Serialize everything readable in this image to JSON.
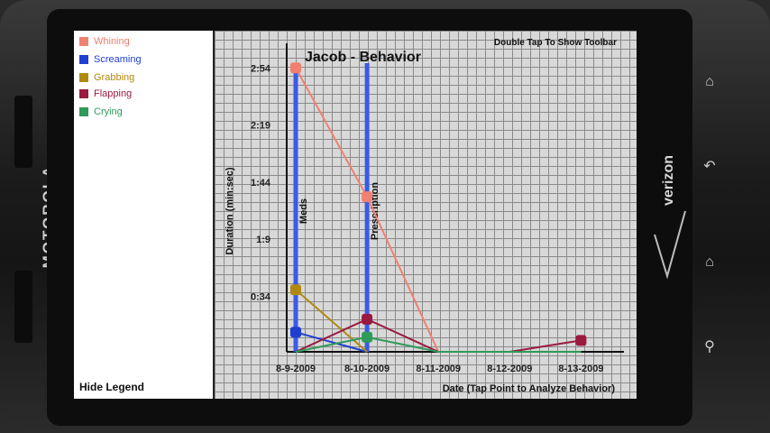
{
  "device": {
    "brand": "MOTOROLA",
    "carrier": "verizon",
    "buttons": [
      {
        "name": "menu",
        "icon": "menu-icon",
        "glyph": "⌂"
      },
      {
        "name": "back",
        "icon": "back-icon",
        "glyph": "↶"
      },
      {
        "name": "home",
        "icon": "home-icon",
        "glyph": "⌂"
      },
      {
        "name": "search",
        "icon": "search-icon",
        "glyph": "⚲"
      }
    ]
  },
  "legend": {
    "items": [
      {
        "label": "Whining",
        "color": "#f08070"
      },
      {
        "label": "Screaming",
        "color": "#1f3fd0"
      },
      {
        "label": "Grabbing",
        "color": "#b08a10"
      },
      {
        "label": "Flapping",
        "color": "#9a1a40"
      },
      {
        "label": "Crying",
        "color": "#2f9a5a"
      }
    ],
    "hide_label": "Hide Legend"
  },
  "chart_data": {
    "type": "line",
    "title": "Jacob - Behavior",
    "toolbar_hint": "Double Tap To Show Toolbar",
    "xlabel": "Date (Tap Point to Analyze Behavior)",
    "ylabel": "Duration (min:sec)",
    "categories": [
      "8-9-2009",
      "8-10-2009",
      "8-11-2009",
      "8-12-2009",
      "8-13-2009"
    ],
    "y_ticks": [
      {
        "label": "2:54",
        "value": 174
      },
      {
        "label": "2:19",
        "value": 139
      },
      {
        "label": "1:44",
        "value": 104
      },
      {
        "label": "1:9",
        "value": 69
      },
      {
        "label": "0:34",
        "value": 34
      }
    ],
    "ylim": [
      0,
      180
    ],
    "grid": true,
    "annotations": [
      {
        "x": "8-9-2009",
        "text": "Meds",
        "color": "#3a5ae8"
      },
      {
        "x": "8-10-2009",
        "text": "Prescription",
        "color": "#3a5ae8"
      }
    ],
    "series": [
      {
        "name": "Whining",
        "color": "#f08070",
        "values": [
          174,
          95,
          0,
          null,
          null
        ]
      },
      {
        "name": "Screaming",
        "color": "#1f3fd0",
        "values": [
          12,
          0,
          null,
          null,
          null
        ]
      },
      {
        "name": "Grabbing",
        "color": "#b08a10",
        "values": [
          38,
          0,
          null,
          null,
          null
        ]
      },
      {
        "name": "Flapping",
        "color": "#9a1a40",
        "values": [
          0,
          20,
          0,
          0,
          7
        ]
      },
      {
        "name": "Crying",
        "color": "#2f9a5a",
        "values": [
          0,
          9,
          0,
          0,
          0
        ]
      }
    ]
  }
}
